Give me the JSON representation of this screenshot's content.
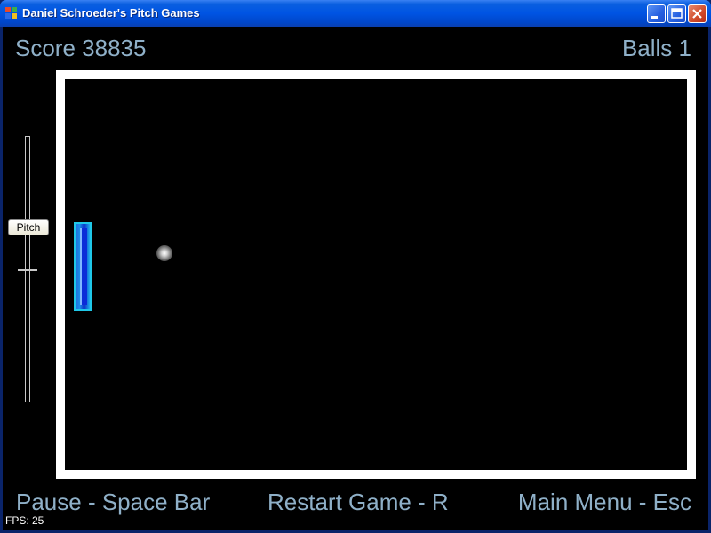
{
  "window": {
    "title": "Daniel Schroeder's Pitch Games"
  },
  "hud": {
    "score_text": "Score 38835",
    "balls_text": "Balls 1"
  },
  "controls": {
    "pitch_label": "Pitch"
  },
  "hints": {
    "pause": "Pause - Space Bar",
    "restart": "Restart Game - R",
    "menu": "Main Menu - Esc"
  },
  "status": {
    "fps_text": "FPS: 25"
  },
  "colors": {
    "hud_text": "#8fb0c8",
    "field_border": "#ffffff",
    "paddle": "#1fb0ec",
    "title_bar": "#0054e3"
  }
}
